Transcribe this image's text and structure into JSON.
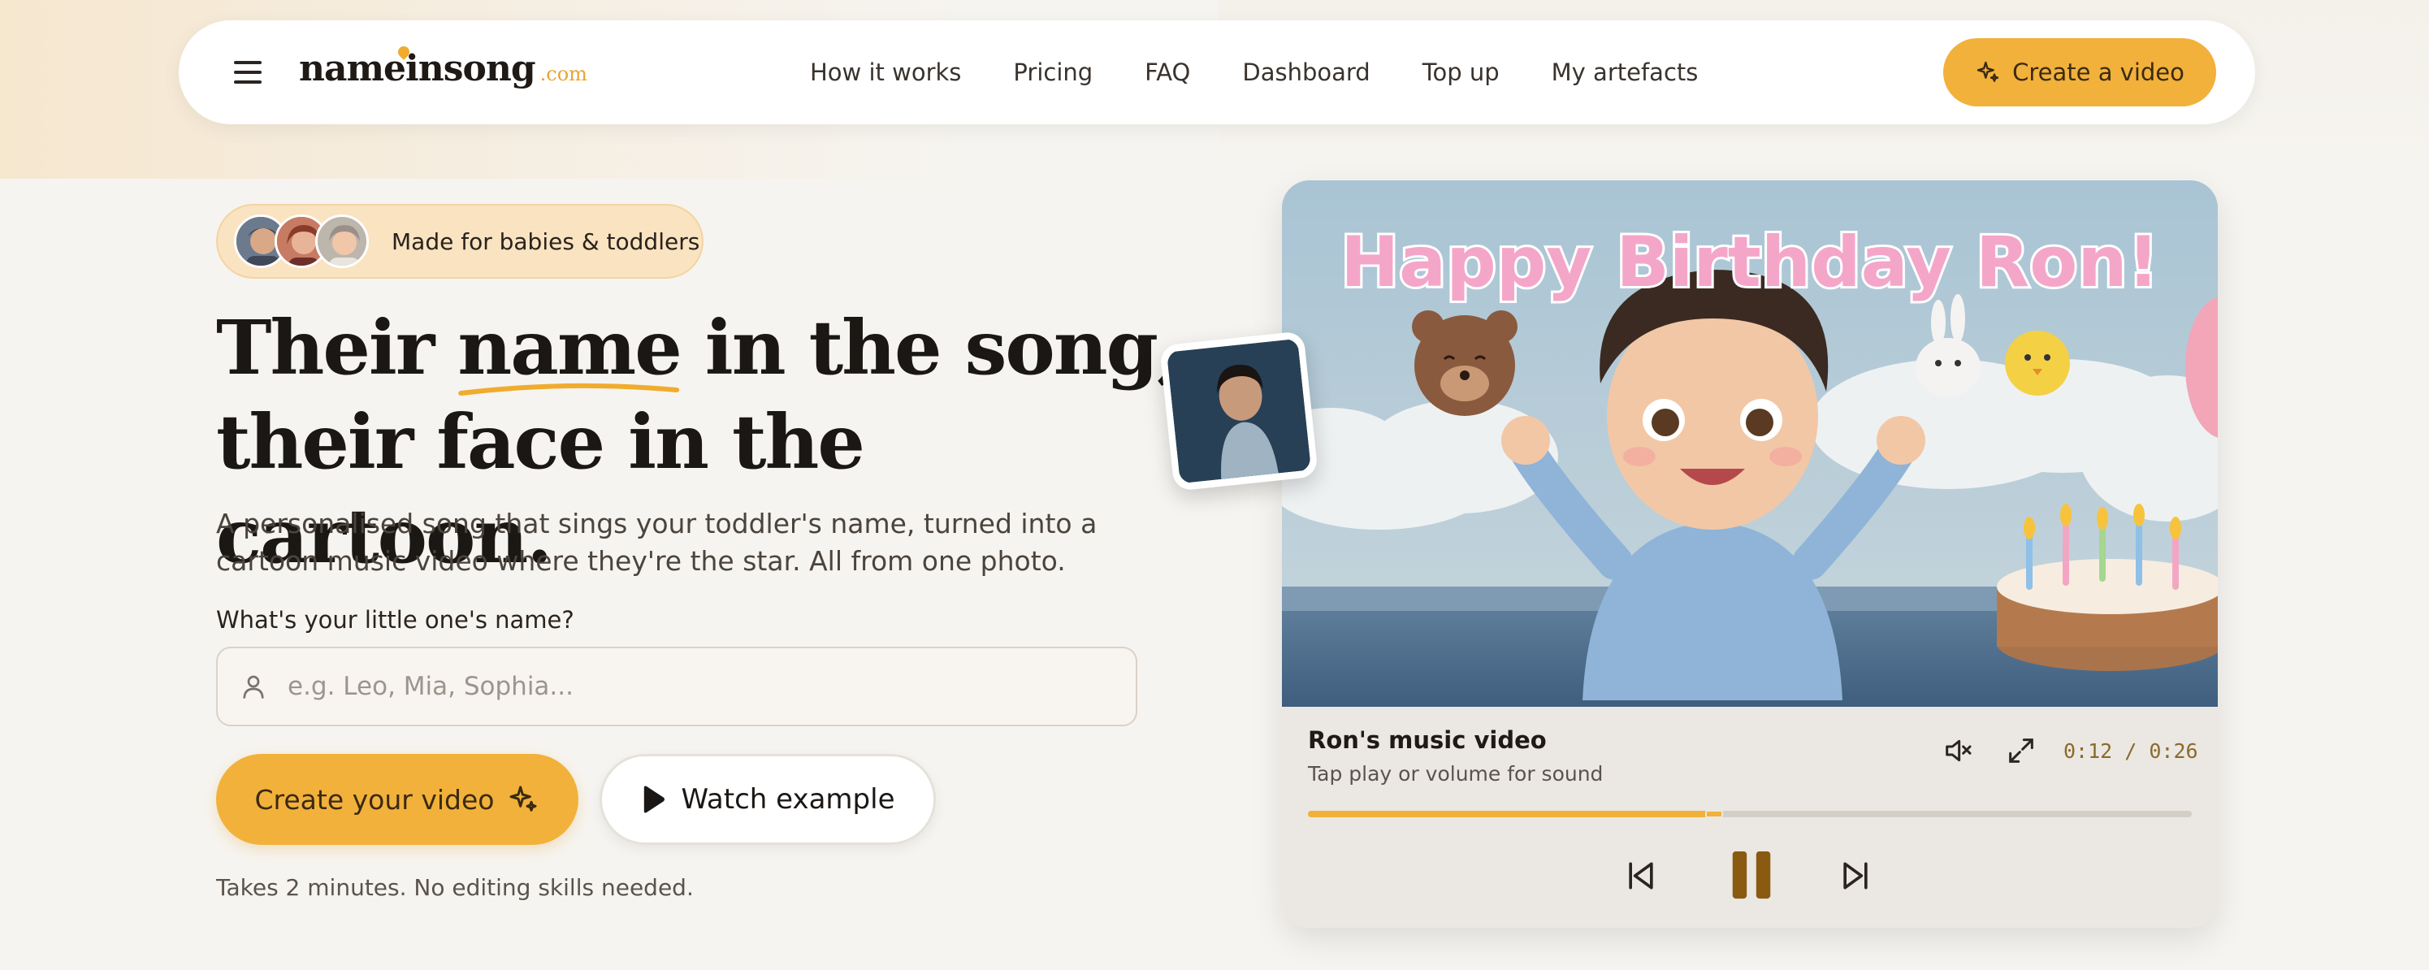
{
  "nav": {
    "logo_main": "nameinsong",
    "logo_tld": ".com",
    "links": [
      "How it works",
      "Pricing",
      "FAQ",
      "Dashboard",
      "Top up",
      "My artefacts"
    ],
    "cta": "Create a video"
  },
  "hero": {
    "badge": "Made for babies & toddlers",
    "headline_pre": "Their ",
    "headline_highlight": "name",
    "headline_post": " in the song,",
    "headline_line2": "their face in the cartoon.",
    "subtitle": "A personalised song that sings your toddler's name, turned into a cartoon music video where they're the star. All from one photo.",
    "field_label": "What's your little one's name?",
    "field_placeholder": "e.g. Leo, Mia, Sophia...",
    "primary_cta": "Create your video",
    "secondary_cta": "Watch example",
    "note": "Takes 2 minutes. No editing skills needed."
  },
  "video": {
    "banner_text": "Happy Birthday Ron!",
    "title": "Ron's music video",
    "subtitle": "Tap play or volume for sound",
    "time": "0:12 / 0:26",
    "progress": 0.46
  },
  "colors": {
    "accent": "#f2b13b",
    "background": "#f6f4f0",
    "badge_bg": "#f9e3c1"
  },
  "icons": [
    "menu-icon",
    "sparkle-icon",
    "user-icon",
    "play-icon",
    "mute-icon",
    "fullscreen-icon",
    "skip-back-icon",
    "pause-icon",
    "skip-forward-icon"
  ]
}
